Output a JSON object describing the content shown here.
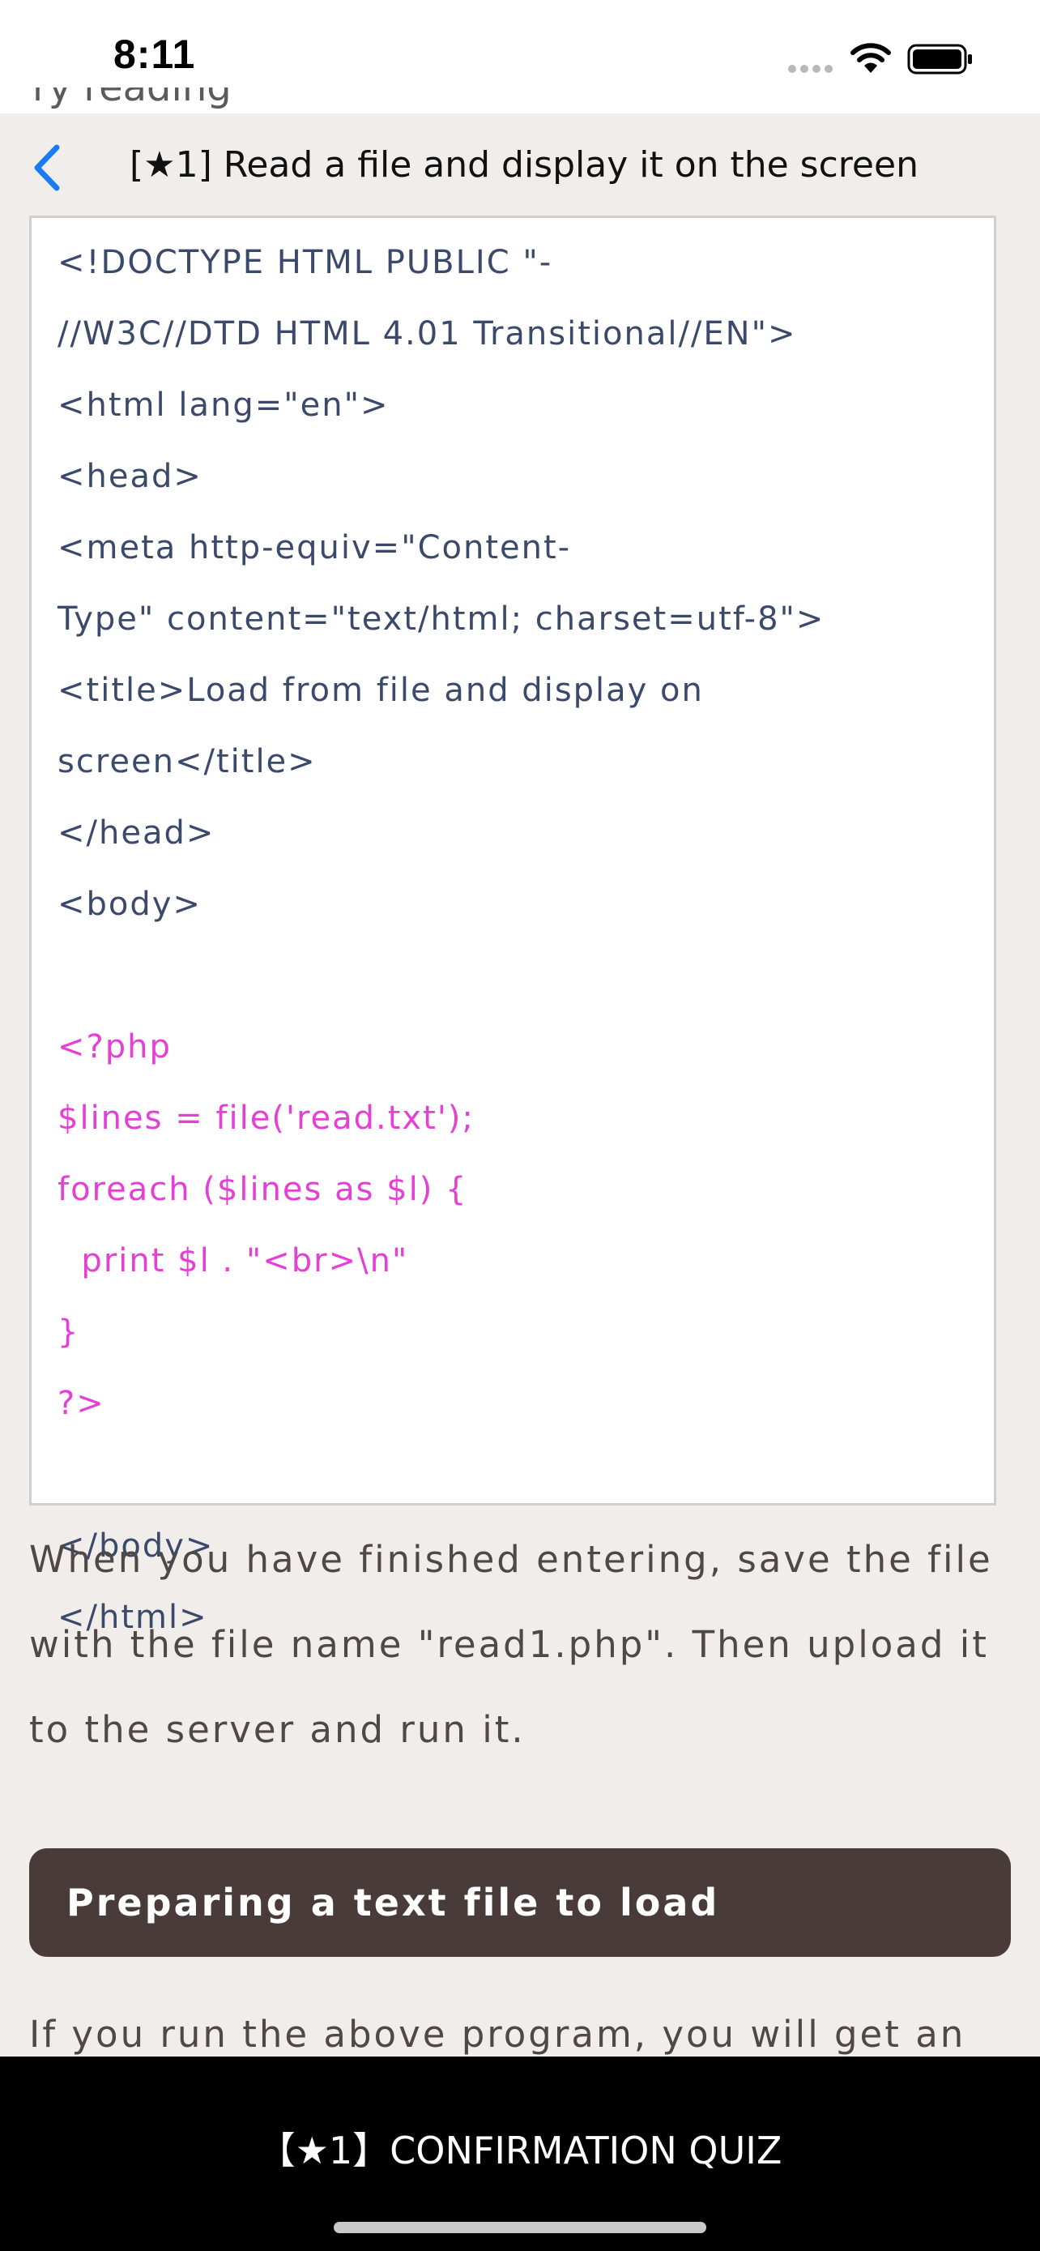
{
  "status_bar": {
    "time": "8:11"
  },
  "nav": {
    "title": "[★1] Read a file and display it on the screen",
    "clipped_text": "ry reading"
  },
  "code": {
    "lines": [
      {
        "text": "<!DOCTYPE HTML PUBLIC \"-",
        "kind": "html"
      },
      {
        "text": "//W3C//DTD HTML 4.01 Transitional//EN\">",
        "kind": "html"
      },
      {
        "text": "<html lang=\"en\">",
        "kind": "html"
      },
      {
        "text": "<head>",
        "kind": "html"
      },
      {
        "text": "<meta http-equiv=\"Content-",
        "kind": "html"
      },
      {
        "text": "Type\" content=\"text/html; charset=utf-8\">",
        "kind": "html"
      },
      {
        "text": "<title>Load from file and display on",
        "kind": "html"
      },
      {
        "text": "screen</title>",
        "kind": "html"
      },
      {
        "text": "</head>",
        "kind": "html"
      },
      {
        "text": "<body>",
        "kind": "html"
      },
      {
        "text": "",
        "kind": "html"
      },
      {
        "text": "<?php",
        "kind": "php"
      },
      {
        "text": "$lines = file('read.txt');",
        "kind": "php"
      },
      {
        "text": "foreach ($lines as $l) {",
        "kind": "php"
      },
      {
        "text": "  print $l . \"<br>\\n\"",
        "kind": "php"
      },
      {
        "text": "}",
        "kind": "php"
      },
      {
        "text": "?>",
        "kind": "php"
      },
      {
        "text": "",
        "kind": "html"
      },
      {
        "text": "</body>",
        "kind": "html"
      },
      {
        "text": "</html>",
        "kind": "html"
      }
    ]
  },
  "paragraph1": {
    "line1": "When you have finished entering, save the file",
    "line2": "with the file name \"read1.php\". Then upload it",
    "line3": "to the server and run it."
  },
  "section": {
    "heading": "Preparing a text file to load"
  },
  "paragraph2": {
    "line1": "If you run the above program, you will get an"
  },
  "bottom": {
    "quiz_label": "【★1】CONFIRMATION QUIZ"
  },
  "colors": {
    "code_html": "#3b4a6b",
    "code_php": "#e53fd6",
    "heading_bg": "#4a3b3b",
    "accent_blue": "#1a7cf5"
  }
}
